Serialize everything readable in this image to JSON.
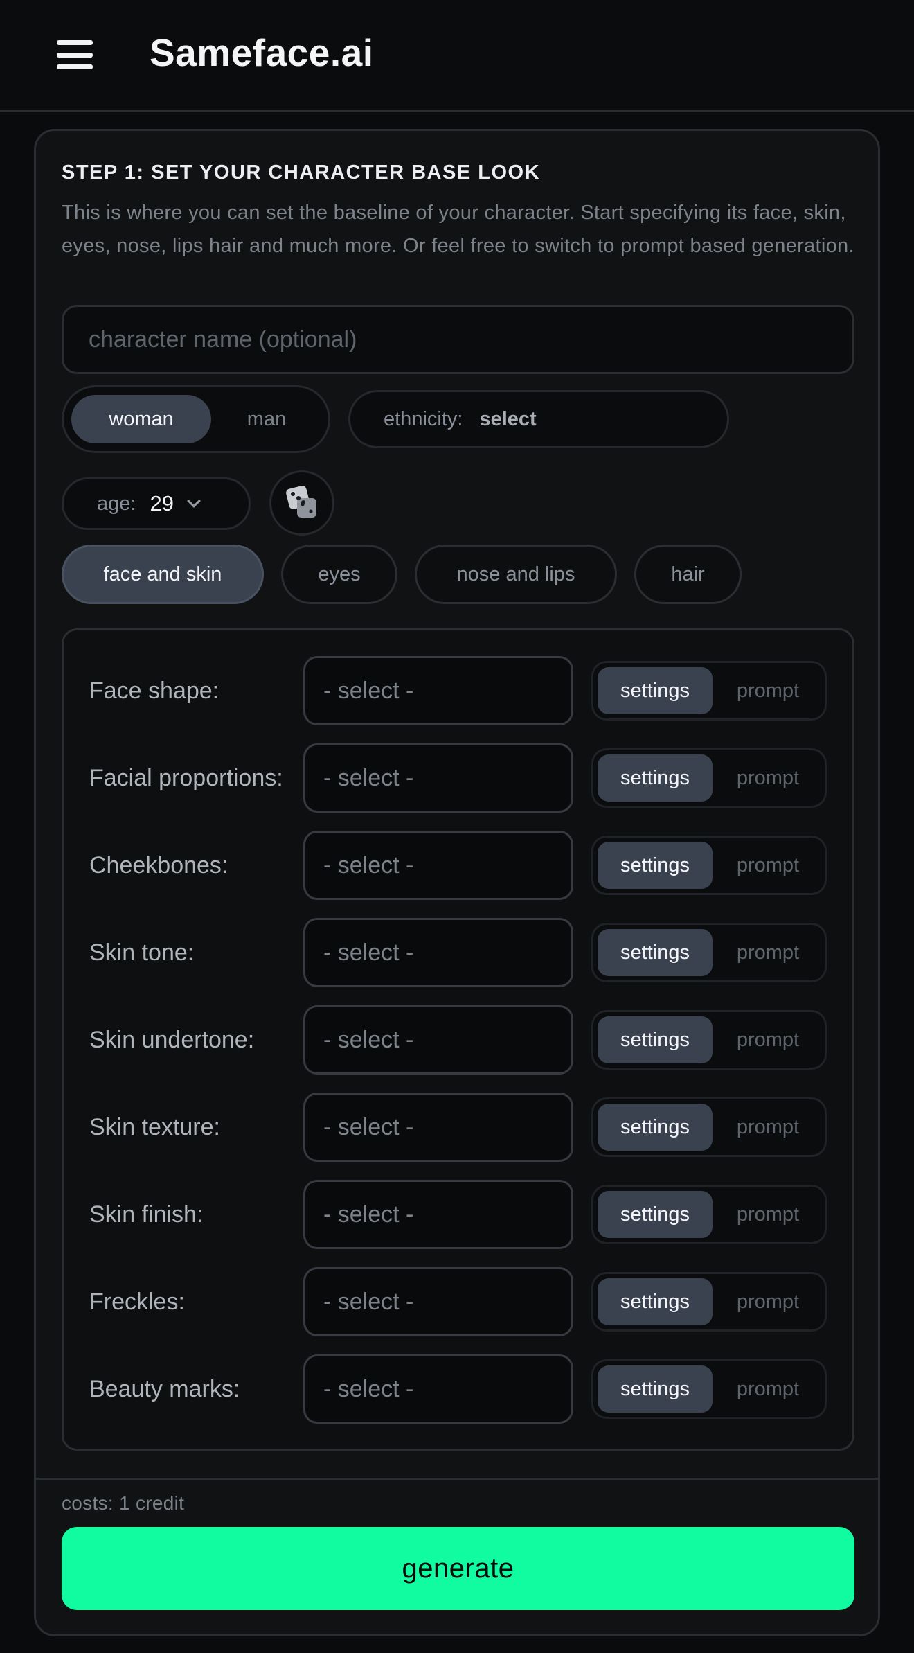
{
  "header": {
    "app_title": "Sameface.ai",
    "menu_icon": "hamburger-menu-icon"
  },
  "step": {
    "title": "STEP 1: SET YOUR CHARACTER BASE LOOK",
    "description": "This is where you can set the baseline of your character. Start specifying its face, skin, eyes, nose, lips hair and much more. Or feel free to switch to prompt based generation."
  },
  "name_input": {
    "placeholder": "character name (optional)",
    "value": ""
  },
  "gender": {
    "options": [
      "woman",
      "man"
    ],
    "selected": "woman"
  },
  "ethnicity": {
    "label": "ethnicity:",
    "value": "select"
  },
  "age": {
    "label": "age:",
    "value": "29"
  },
  "randomize_icon": "dice-icon",
  "tabs": [
    {
      "label": "face and skin",
      "active": true
    },
    {
      "label": "eyes",
      "active": false
    },
    {
      "label": "nose and lips",
      "active": false
    },
    {
      "label": "hair",
      "active": false
    }
  ],
  "attributes": [
    {
      "label": "Face shape:",
      "value": "- select -",
      "mode_on": "settings",
      "mode_off": "prompt"
    },
    {
      "label": "Facial proportions:",
      "value": "- select -",
      "mode_on": "settings",
      "mode_off": "prompt"
    },
    {
      "label": "Cheekbones:",
      "value": "- select -",
      "mode_on": "settings",
      "mode_off": "prompt"
    },
    {
      "label": "Skin tone:",
      "value": "- select -",
      "mode_on": "settings",
      "mode_off": "prompt"
    },
    {
      "label": "Skin undertone:",
      "value": "- select -",
      "mode_on": "settings",
      "mode_off": "prompt"
    },
    {
      "label": "Skin texture:",
      "value": "- select -",
      "mode_on": "settings",
      "mode_off": "prompt"
    },
    {
      "label": "Skin finish:",
      "value": "- select -",
      "mode_on": "settings",
      "mode_off": "prompt"
    },
    {
      "label": "Freckles:",
      "value": "- select -",
      "mode_on": "settings",
      "mode_off": "prompt"
    },
    {
      "label": "Beauty marks:",
      "value": "- select -",
      "mode_on": "settings",
      "mode_off": "prompt"
    }
  ],
  "footer": {
    "cost": "costs: 1 credit",
    "generate_label": "generate"
  },
  "colors": {
    "background": "#0a0b0c",
    "card": "#111214",
    "active_pill": "#3a4250",
    "accent": "#11fba1"
  }
}
